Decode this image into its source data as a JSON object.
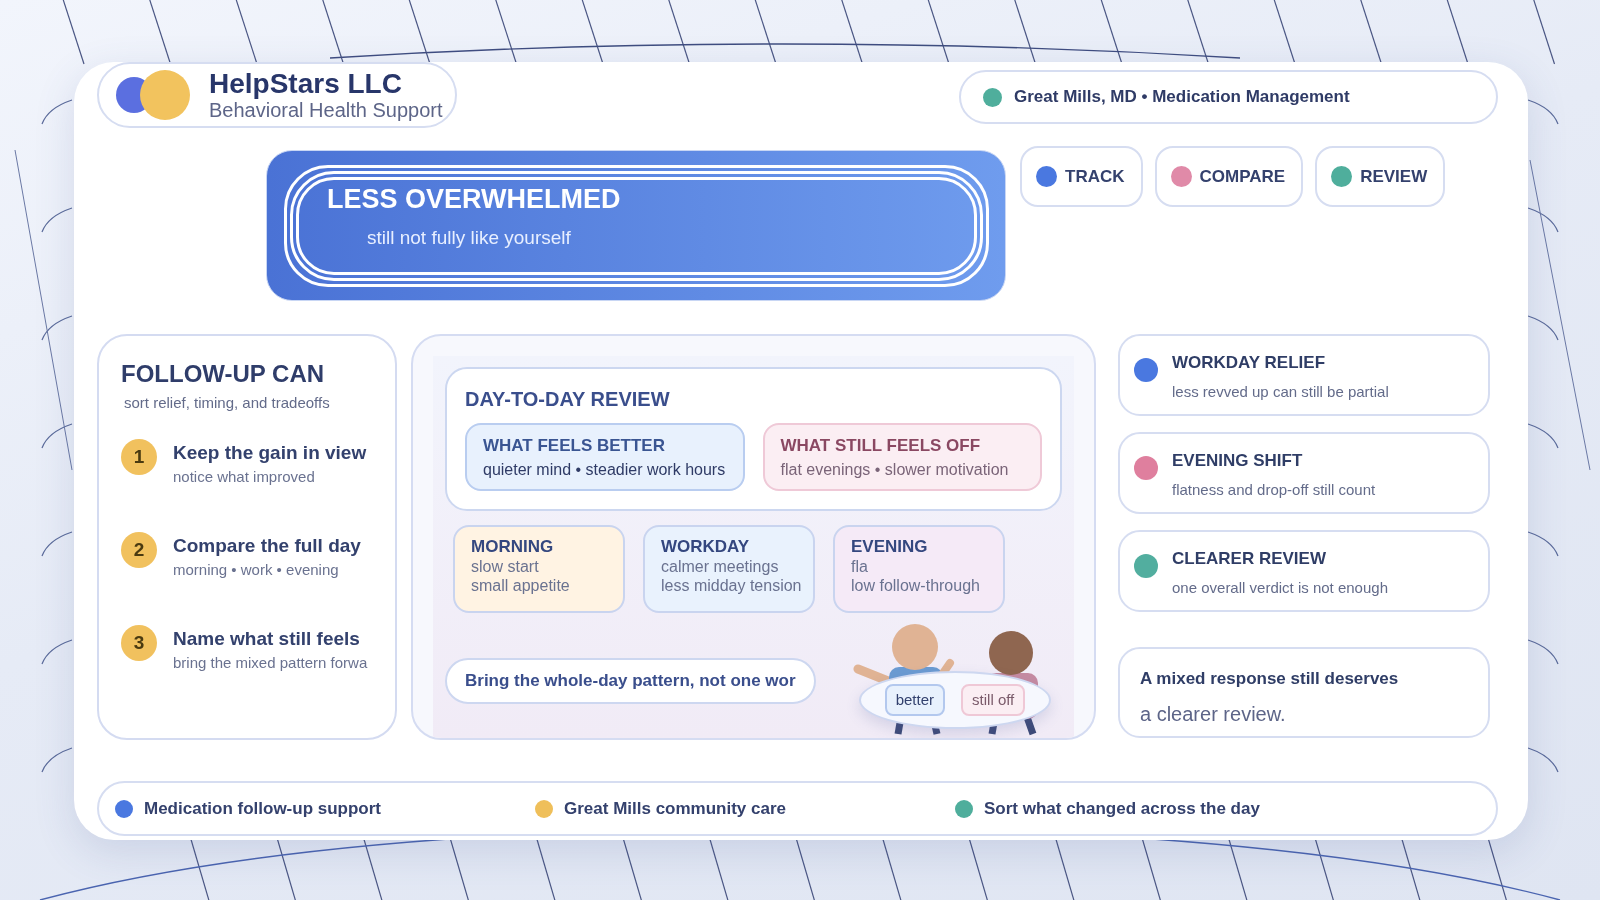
{
  "brand": {
    "name": "HelpStars LLC",
    "tagline": "Behavioral Health Support"
  },
  "location": {
    "text": "Great Mills, MD • Medication Management"
  },
  "banner": {
    "title": "LESS OVERWHELMED",
    "subtitle": "still not fully like yourself"
  },
  "steps": [
    {
      "label": "TRACK",
      "color": "#4a78e0"
    },
    {
      "label": "COMPARE",
      "color": "#e08aa8"
    },
    {
      "label": "REVIEW",
      "color": "#4fae9c"
    }
  ],
  "follow_up": {
    "title": "FOLLOW-UP CAN",
    "subtitle": "sort relief, timing, and tradeoffs",
    "items": [
      {
        "number": "1",
        "title": "Keep the gain in view",
        "detail": "notice what improved"
      },
      {
        "number": "2",
        "title": "Compare the full day",
        "detail": "morning • work • evening"
      },
      {
        "number": "3",
        "title": "Name what still feels",
        "detail": "bring the mixed pattern forwa"
      }
    ]
  },
  "review": {
    "title": "DAY-TO-DAY REVIEW",
    "columns": [
      {
        "kind": "better",
        "title": "WHAT FEELS BETTER",
        "detail": "quieter mind • steadier work hours"
      },
      {
        "kind": "off",
        "title": "WHAT STILL FEELS OFF",
        "detail": "flat evenings • slower motivation"
      }
    ],
    "periods": [
      {
        "title": "MORNING",
        "lines": [
          "slow start",
          "small appetite"
        ],
        "color": "#fff3e3"
      },
      {
        "title": "WORKDAY",
        "lines": [
          "calmer meetings",
          "less midday tension"
        ],
        "color": "#e9f2fd"
      },
      {
        "title": "EVENING",
        "lines": [
          "fla",
          "low follow-through"
        ],
        "color": "#f5eaf7"
      }
    ],
    "note": "Bring the whole-day pattern, not one wor",
    "bubble": [
      {
        "kind": "better",
        "label": "better"
      },
      {
        "kind": "off",
        "label": "still off"
      }
    ]
  },
  "highlights": [
    {
      "title": "WORKDAY RELIEF",
      "detail": "less revved up can still be partial",
      "color": "#4a78e0"
    },
    {
      "title": "EVENING SHIFT",
      "detail": "flatness and drop-off still count",
      "color": "#df7f9e"
    },
    {
      "title": "CLEARER REVIEW",
      "detail": "one overall verdict is not enough",
      "color": "#52ae9f"
    }
  ],
  "callout": {
    "title": "A mixed response still deserves",
    "text": "a clearer review."
  },
  "footer": [
    {
      "label": "Medication follow-up support",
      "color": "#4a78e0"
    },
    {
      "label": "Great Mills community care",
      "color": "#efbf5a"
    },
    {
      "label": "Sort what changed across the day",
      "color": "#4fae9c"
    }
  ]
}
